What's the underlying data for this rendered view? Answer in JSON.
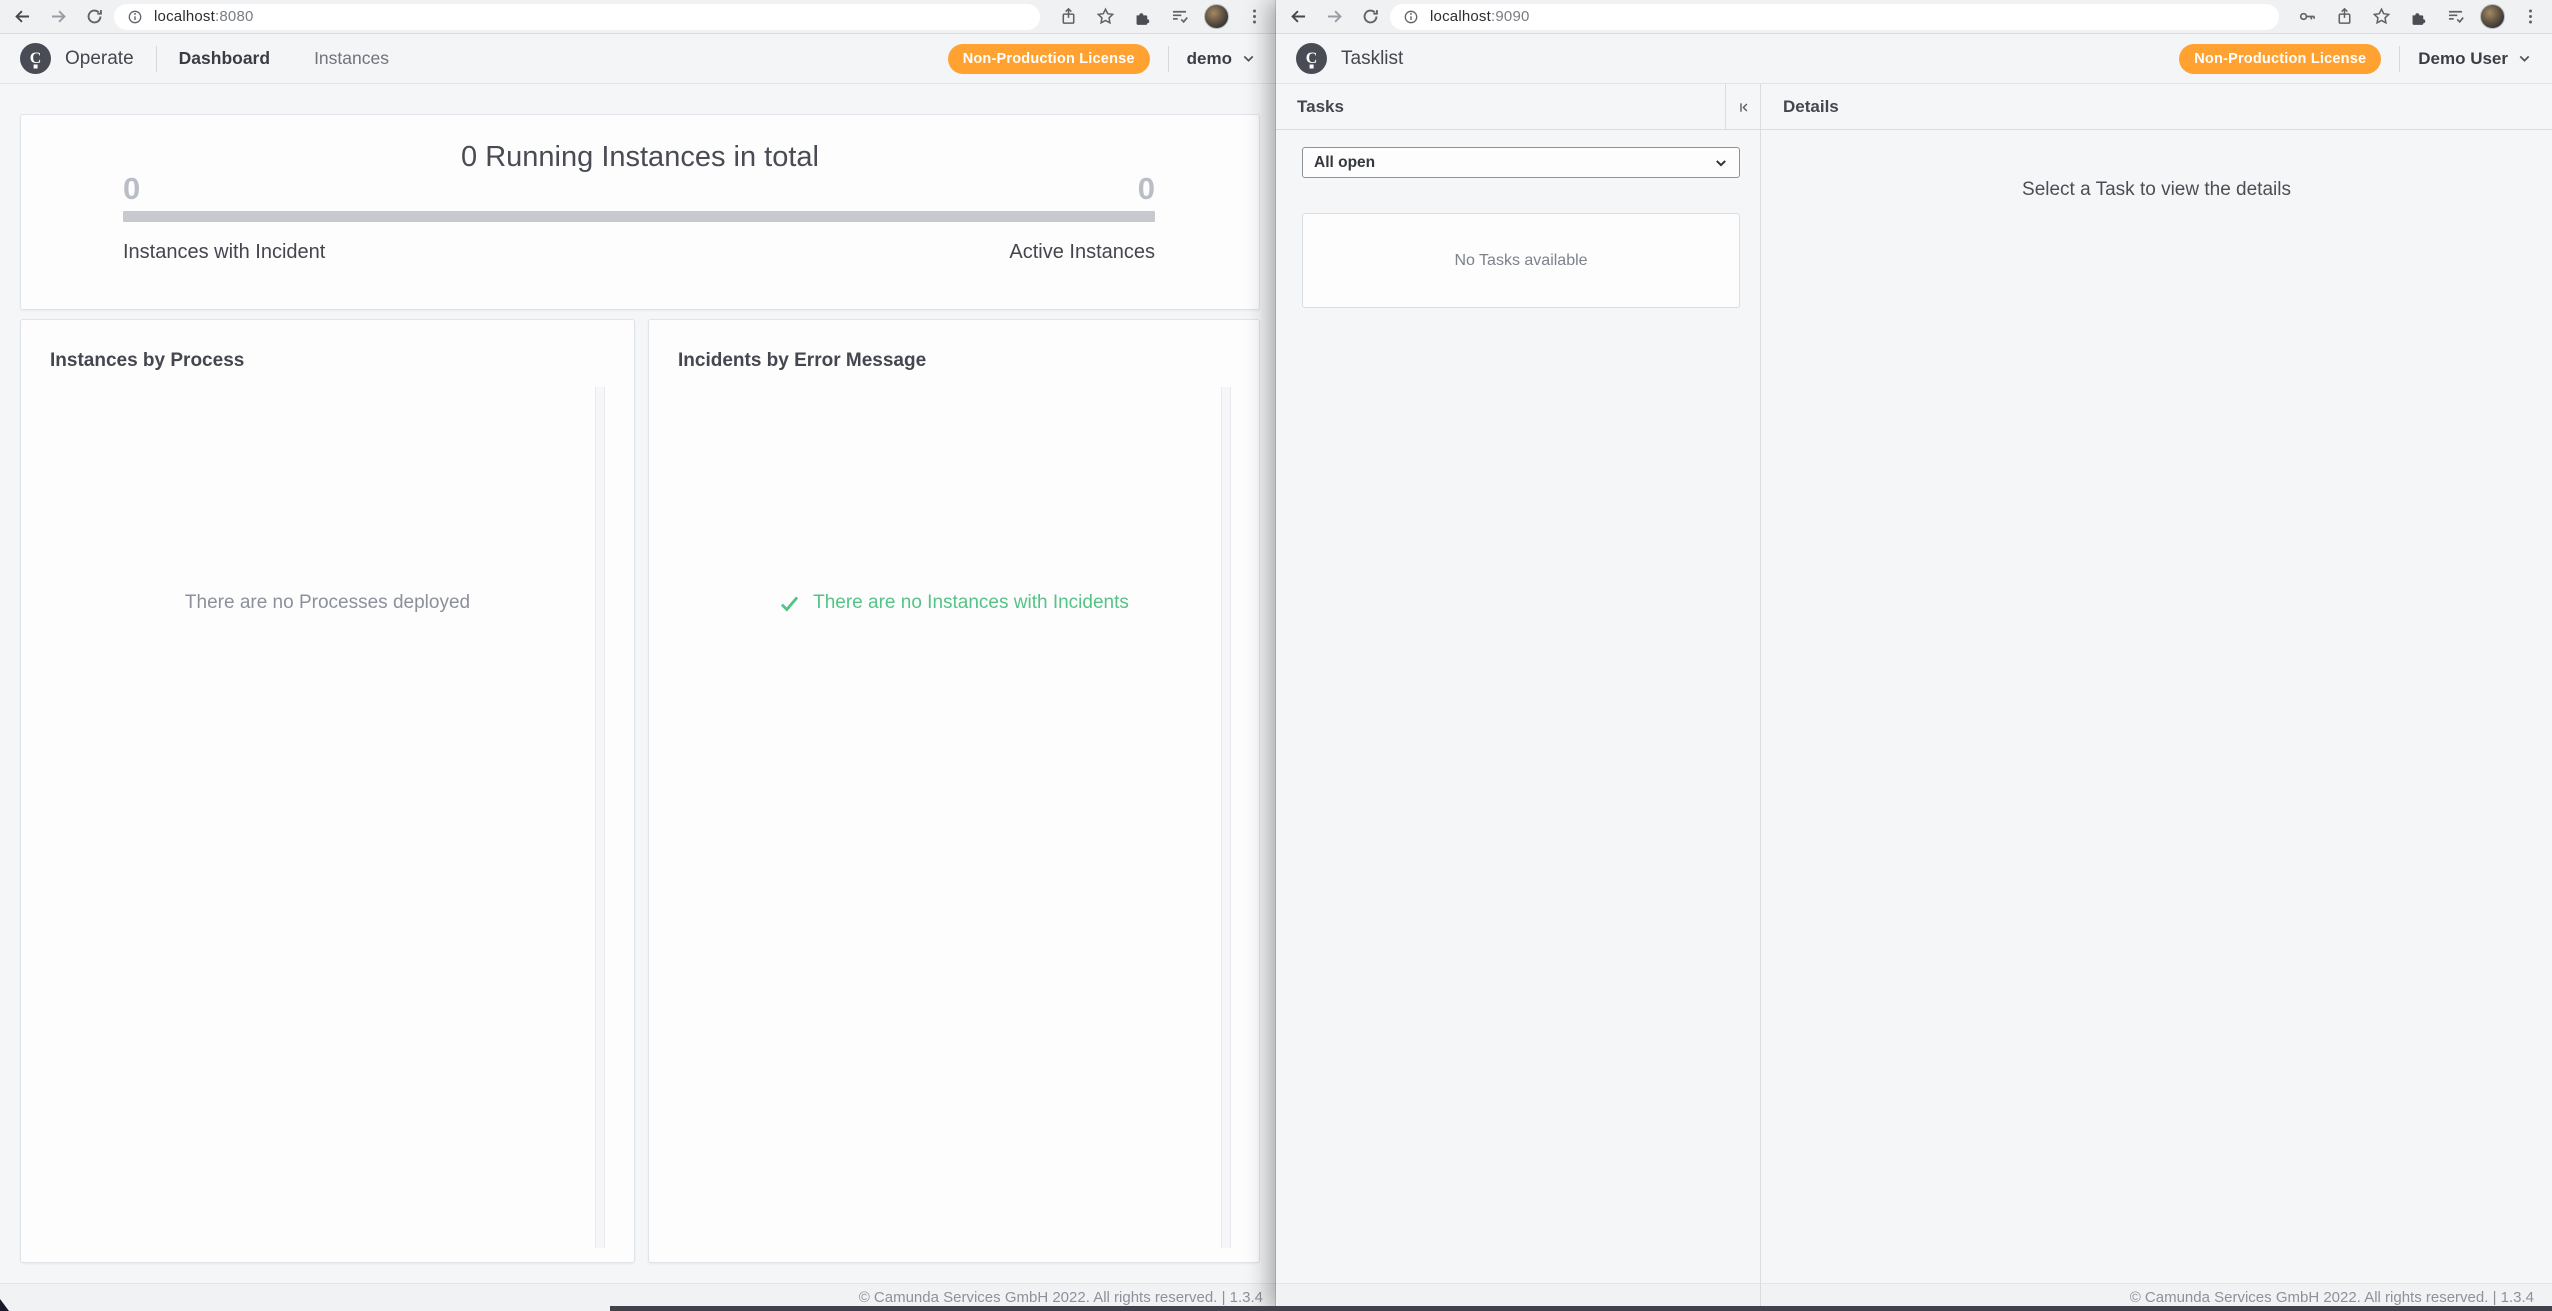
{
  "colors": {
    "accent_orange": "#FFA231",
    "success_green": "#55C386"
  },
  "operate": {
    "browser": {
      "url_host": "localhost",
      "url_port": ":8080"
    },
    "header": {
      "app_name": "Operate",
      "nav": [
        {
          "label": "Dashboard",
          "active": true
        },
        {
          "label": "Instances",
          "active": false
        }
      ],
      "license_label": "Non-Production License",
      "user_name": "demo"
    },
    "metrics": {
      "title": "0 Running Instances in total",
      "incidents_value": "0",
      "incidents_label": "Instances with Incident",
      "active_value": "0",
      "active_label": "Active Instances"
    },
    "panels": {
      "instances_by_process": {
        "title": "Instances by Process",
        "empty_message": "There are no Processes deployed"
      },
      "incidents_by_error": {
        "title": "Incidents by Error Message",
        "empty_message": "There are no Instances with Incidents"
      }
    },
    "footer": "© Camunda Services GmbH 2022. All rights reserved. | 1.3.4"
  },
  "tasklist": {
    "browser": {
      "url_host": "localhost",
      "url_port": ":9090"
    },
    "header": {
      "app_name": "Tasklist",
      "license_label": "Non-Production License",
      "user_name": "Demo User"
    },
    "tasks_panel": {
      "title": "Tasks",
      "filter_value": "All open",
      "empty_message": "No Tasks available"
    },
    "details_panel": {
      "title": "Details",
      "empty_message": "Select a Task to view the details"
    },
    "footer": "© Camunda Services GmbH 2022. All rights reserved. | 1.3.4"
  }
}
